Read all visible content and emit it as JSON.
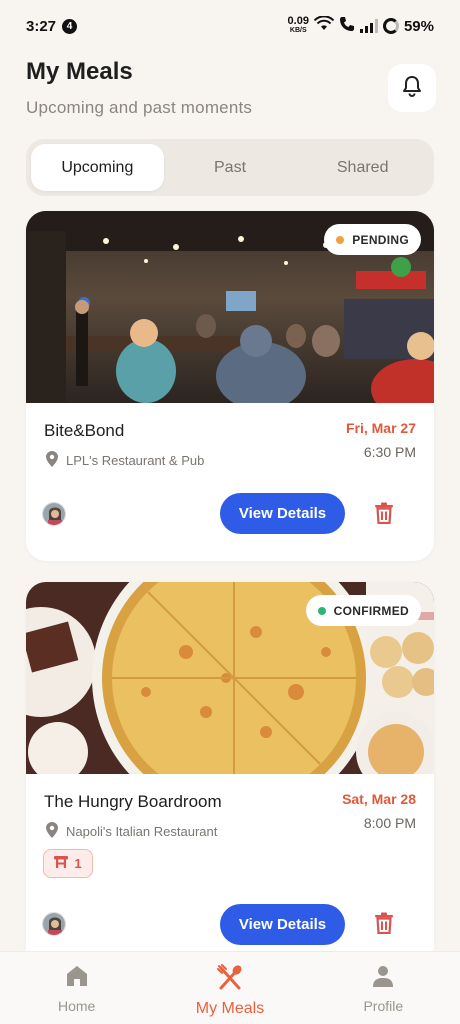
{
  "status_bar": {
    "time": "3:27",
    "notification_count": "4",
    "speed_value": "0.09",
    "speed_unit": "KB/S",
    "battery": "59%"
  },
  "header": {
    "title": "My Meals",
    "subtitle": "Upcoming and past moments",
    "bell_icon": "bell-icon"
  },
  "tabs": [
    {
      "label": "Upcoming",
      "active": true
    },
    {
      "label": "Past",
      "active": false
    },
    {
      "label": "Shared",
      "active": false
    }
  ],
  "meals": [
    {
      "name": "Bite&Bond",
      "venue": "LPL's Restaurant & Pub",
      "date": "Fri, Mar 27",
      "time": "6:30 PM",
      "status": "PENDING",
      "status_color": "#f0a03c",
      "date_color": "#e0593a",
      "action_label": "View Details"
    },
    {
      "name": "The Hungry Boardroom",
      "venue": "Napoli's Italian Restaurant",
      "date": "Sat, Mar 28",
      "time": "8:00 PM",
      "status": "CONFIRMED",
      "status_color": "#2bb673",
      "date_color": "#e0593a",
      "table_count": "1",
      "action_label": "View Details"
    }
  ],
  "bottom_nav": [
    {
      "label": "Home",
      "icon": "home-icon",
      "active": false
    },
    {
      "label": "My Meals",
      "icon": "fork-knife-icon",
      "active": true
    },
    {
      "label": "Profile",
      "icon": "person-icon",
      "active": false
    }
  ],
  "colors": {
    "accent": "#2e5ce6",
    "brand": "#e8623f",
    "danger": "#d9534f",
    "background": "#f8f5f1"
  }
}
